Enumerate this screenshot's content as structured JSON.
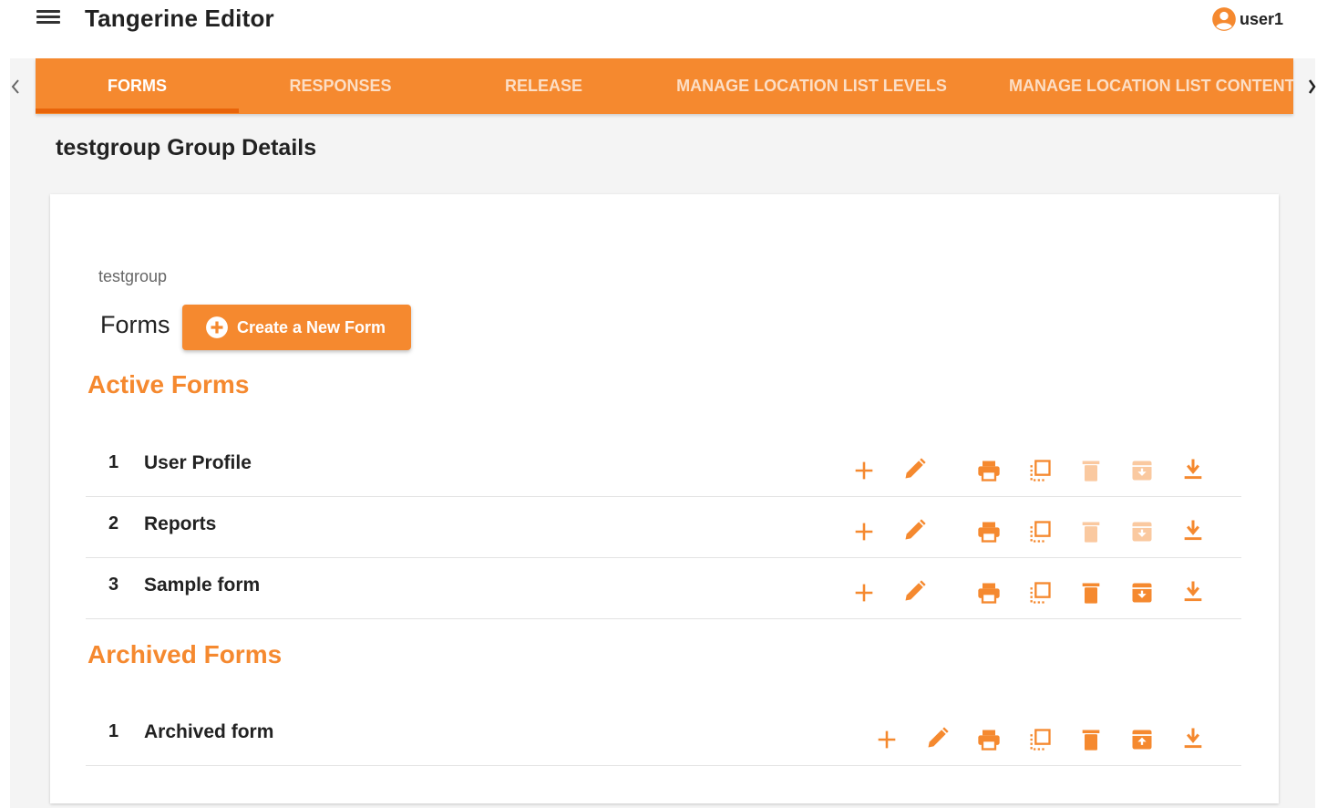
{
  "app": {
    "title": "Tangerine Editor",
    "menu_icon": "menu-icon"
  },
  "user": {
    "name": "user1",
    "icon": "account-circle-icon"
  },
  "tabs": [
    {
      "label": "FORMS",
      "active": true
    },
    {
      "label": "RESPONSES",
      "active": false
    },
    {
      "label": "RELEASE",
      "active": false
    },
    {
      "label": "MANAGE LOCATION LIST LEVELS",
      "active": false
    },
    {
      "label": "MANAGE LOCATION LIST CONTENT",
      "active": false
    }
  ],
  "tab_scroll": {
    "left_icon": "chevron-left-icon",
    "right_icon": "chevron-right-icon"
  },
  "page": {
    "title": "testgroup Group Details"
  },
  "card": {
    "group_name": "testgroup",
    "forms_label": "Forms",
    "create_button": {
      "label": "Create a New Form",
      "icon": "add-circle-icon"
    }
  },
  "active_forms": {
    "title": "Active Forms",
    "rows": [
      {
        "num": "1",
        "name": "User Profile",
        "delete_enabled": false,
        "archive_enabled": false
      },
      {
        "num": "2",
        "name": "Reports",
        "delete_enabled": false,
        "archive_enabled": false
      },
      {
        "num": "3",
        "name": "Sample form",
        "delete_enabled": true,
        "archive_enabled": true
      }
    ]
  },
  "archived_forms": {
    "title": "Archived Forms",
    "rows": [
      {
        "num": "1",
        "name": "Archived form"
      }
    ]
  },
  "row_actions": [
    "add-icon",
    "edit-icon",
    "print-icon",
    "copy-icon",
    "delete-icon",
    "archive-icon",
    "download-icon"
  ],
  "colors": {
    "accent": "#f5892f",
    "accent_dark": "#e8640a",
    "page_bg": "#f4f4f4"
  }
}
